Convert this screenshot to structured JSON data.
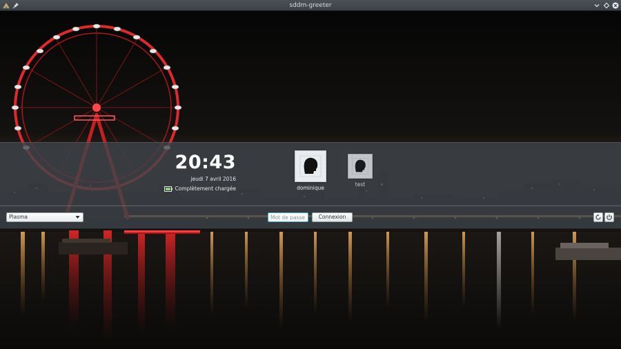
{
  "window": {
    "title": "sddm-greeter"
  },
  "clock": {
    "time": "20:43",
    "date": "jeudi 7 avril 2016"
  },
  "battery": {
    "status": "Complètement chargée"
  },
  "users": [
    {
      "name": "dominique",
      "selected": true
    },
    {
      "name": "test",
      "selected": false
    }
  ],
  "session": {
    "selected": "Plasma"
  },
  "password": {
    "placeholder": "Mot de passe",
    "value": ""
  },
  "login": {
    "label": "Connexion"
  },
  "icons": {
    "app": "sddm-app-icon",
    "pin": "pin-icon",
    "minimize": "chevron-down-icon",
    "maximize": "diamond-icon",
    "close": "close-icon",
    "battery": "battery-icon",
    "avatar": "user-silhouette-icon",
    "reboot": "reboot-icon",
    "shutdown": "power-icon",
    "caret": "caret-down-icon"
  },
  "colors": {
    "accent": "#3daee9",
    "panel": "#3e444a",
    "titlebar": "#40474d"
  }
}
